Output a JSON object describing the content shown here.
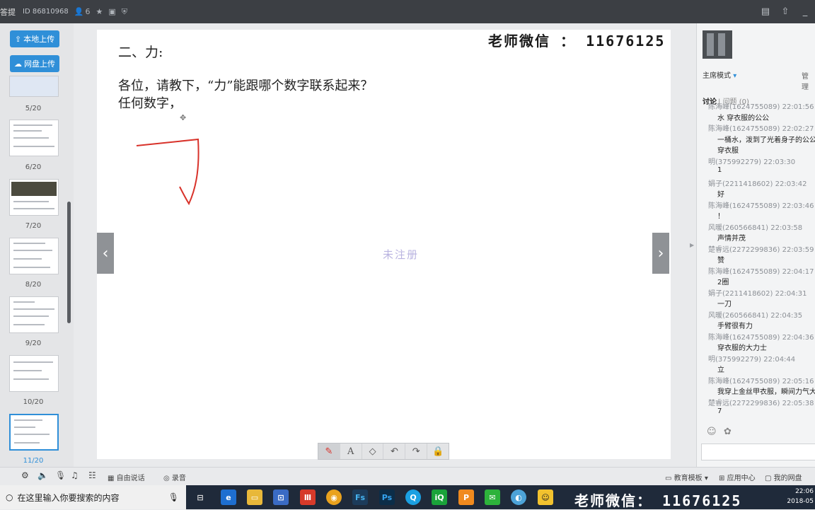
{
  "window": {
    "title": "答提",
    "room_id": "ID 86810968",
    "people_count": "6"
  },
  "left_panel": {
    "upload_local": "本地上传",
    "upload_cloud": "网盘上传",
    "slides": [
      {
        "label": "5/20"
      },
      {
        "label": "6/20"
      },
      {
        "label": "7/20"
      },
      {
        "label": "8/20"
      },
      {
        "label": "9/20"
      },
      {
        "label": "10/20"
      },
      {
        "label": "11/20",
        "selected": true
      }
    ]
  },
  "slide": {
    "heading": "二、力:",
    "line1": "各位，请教下，“力”能跟哪个数字联系起来？",
    "line2": "任何数字，",
    "watermark": "老师微信 ： 11676125",
    "unregistered": "未注册"
  },
  "draw_tools": [
    "pen-icon",
    "text-icon",
    "eraser-icon",
    "undo-icon",
    "redo-icon",
    "lock-icon"
  ],
  "right_panel": {
    "mode_label": "主席模式",
    "manage_label": "管理",
    "tab_discussion": "讨论",
    "tab_questions": "问题 (0)",
    "chat": [
      {
        "time": "陈海峰(1624755089) 22:01:56",
        "msg": "水 穿衣服的公公"
      },
      {
        "time": "陈海峰(1624755089) 22:02:27",
        "msg": "一桶水，泼到了光着身子的公公"
      },
      {
        "time": "",
        "msg": "穿衣服"
      },
      {
        "time": "明(375992279) 22:03:30",
        "msg": "1"
      },
      {
        "time": "娟子(2211418602) 22:03:42",
        "msg": "好"
      },
      {
        "time": "陈海峰(1624755089) 22:03:46",
        "msg": "！"
      },
      {
        "time": "风暖(260566841) 22:03:58",
        "msg": "声情并茂"
      },
      {
        "time": "楚睿远(2272299836) 22:03:59",
        "msg": "赞"
      },
      {
        "time": "陈海峰(1624755089) 22:04:17",
        "msg": "2圈"
      },
      {
        "time": "娟子(2211418602) 22:04:31",
        "msg": "一刀"
      },
      {
        "time": "风暖(260566841) 22:04:35",
        "msg": "手臂很有力"
      },
      {
        "time": "陈海峰(1624755089) 22:04:36",
        "msg": "穿衣服的大力士"
      },
      {
        "time": "明(375992279) 22:04:44",
        "msg": "立"
      },
      {
        "time": "陈海峰(1624755089) 22:05:16",
        "msg": "我穿上金丝甲衣服，瞬间力气大"
      },
      {
        "time": "楚睿远(2272299836) 22:05:38",
        "msg": "7"
      }
    ]
  },
  "bottom_bar": {
    "free_talk": "自由说话",
    "record": "录音",
    "edu_template": "教育模板",
    "app_center": "应用中心",
    "my_drive": "我的网盘"
  },
  "taskbar": {
    "search_placeholder": "在这里输入你要搜索的内容",
    "watermark": "老师微信： 11676125",
    "time": "22:06",
    "date": "2018-05"
  },
  "colors": {
    "accent": "#2f8fd8",
    "drawing": "#d8322a"
  }
}
